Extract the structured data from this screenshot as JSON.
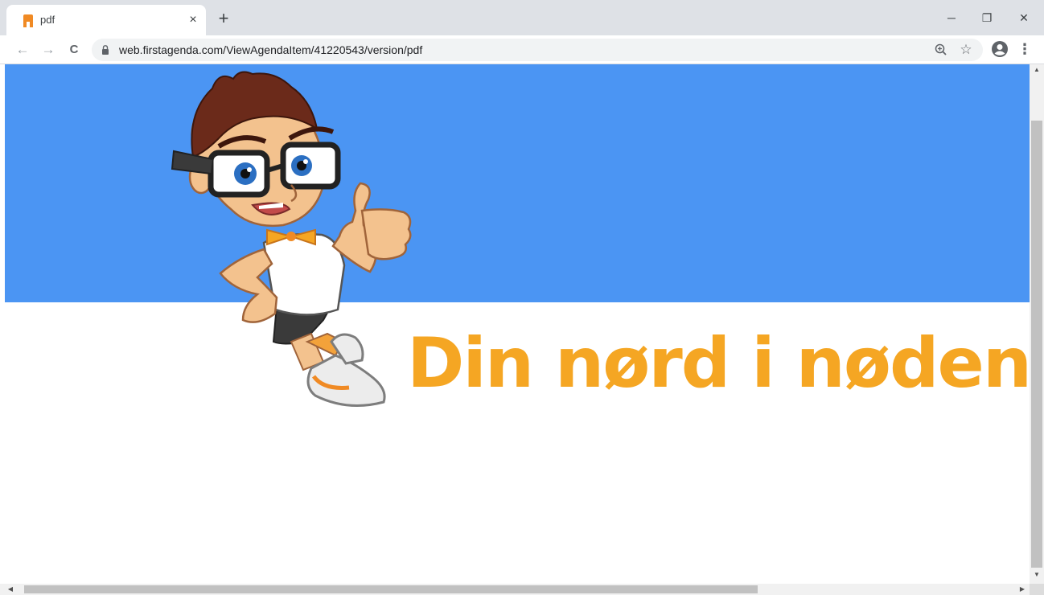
{
  "browser": {
    "tab": {
      "title": "pdf",
      "close_glyph": "×",
      "favicon": "firstagenda-icon"
    },
    "new_tab_glyph": "+",
    "window_controls": {
      "minimize_glyph": "─",
      "restore_glyph": "❐",
      "close_glyph": "✕"
    },
    "nav": {
      "back_glyph": "←",
      "forward_glyph": "→",
      "reload_glyph": "C"
    },
    "url": "web.firstagenda.com/ViewAgendaItem/41220543/version/pdf",
    "icons": [
      "lock-icon",
      "zoom-icon",
      "star-icon",
      "profile-icon",
      "menu-icon"
    ],
    "star_glyph": "☆",
    "menu_glyph": "⋮"
  },
  "page": {
    "banner_color": "#4b95f3",
    "slogan": "Din nørd i nøden.",
    "slogan_color": "#f5a623"
  },
  "scrollbars": {
    "up_glyph": "▲",
    "down_glyph": "▼",
    "left_glyph": "◀",
    "right_glyph": "▶"
  }
}
